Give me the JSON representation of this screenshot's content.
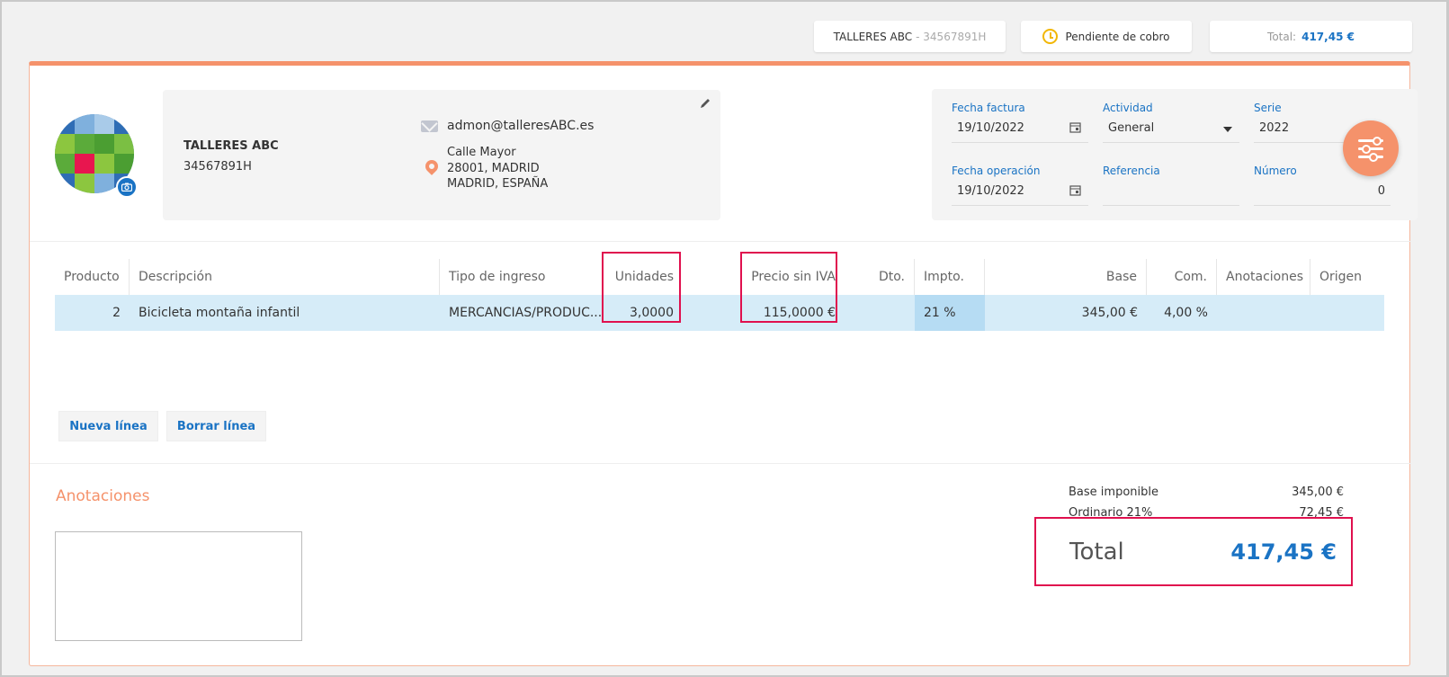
{
  "header": {
    "client_name": "TALLERES ABC",
    "client_nif": "- 34567891H",
    "status": "Pendiente de cobro",
    "total_label": "Total:",
    "total_value": "417,45 €"
  },
  "client": {
    "name": "TALLERES ABC",
    "nif": "34567891H",
    "email": "admon@talleresABC.es",
    "address_line1": "Calle Mayor",
    "address_line2": "28001, MADRID",
    "address_line3": "MADRID, ESPAÑA"
  },
  "invoice": {
    "fecha_factura_label": "Fecha factura",
    "fecha_factura": "19/10/2022",
    "actividad_label": "Actividad",
    "actividad": "General",
    "serie_label": "Serie",
    "serie": "2022",
    "fecha_operacion_label": "Fecha operación",
    "fecha_operacion": "19/10/2022",
    "referencia_label": "Referencia",
    "referencia": "",
    "numero_label": "Número",
    "numero": "0"
  },
  "table": {
    "headers": [
      "Producto",
      "Descripción",
      "Tipo de ingreso",
      "Unidades",
      "Precio sin IVA",
      "Dto.",
      "Impto.",
      "Base",
      "Com.",
      "Anotaciones",
      "Origen"
    ],
    "rows": [
      {
        "producto": "2",
        "descripcion": "Bicicleta montaña infantil",
        "tipo": "MERCANCIAS/PRODUC...",
        "unidades": "3,0000",
        "precio": "115,0000 €",
        "dto": "",
        "impto": "21 %",
        "base": "345,00 €",
        "com": "4,00 %",
        "anotaciones": "",
        "origen": ""
      }
    ]
  },
  "actions": {
    "nueva_linea": "Nueva línea",
    "borrar_linea": "Borrar línea"
  },
  "annotations": {
    "title": "Anotaciones",
    "text": ""
  },
  "summary": {
    "base_label": "Base imponible",
    "base_value": "345,00 €",
    "iva_label": "Ordinario 21%",
    "iva_value": "72,45 €",
    "total_label": "Total",
    "total_value": "417,45 €"
  },
  "colors": {
    "accent": "#f5926b",
    "primary": "#1a73c4",
    "highlight": "#e0104e",
    "row_selected": "#d6ecf8"
  }
}
